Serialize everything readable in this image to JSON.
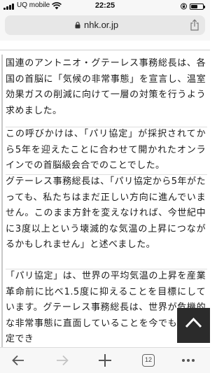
{
  "status_bar": {
    "carrier": "UQ mobile",
    "time": "22:25",
    "battery_level": 0.55,
    "icons": [
      "signal-icon",
      "wifi-icon",
      "lock-rotation-icon",
      "battery-icon"
    ]
  },
  "browser": {
    "url": "nhk.or.jp",
    "tab_count": "12",
    "icons": [
      "lock-icon",
      "share-icon",
      "back-icon",
      "forward-icon",
      "new-tab-icon",
      "tabs-icon",
      "more-icon"
    ]
  },
  "article": {
    "paragraphs": [
      "国連のアントニオ・グテーレス事務総長は、各国の首脳に「気候の非常事態」を宣言し、温室効果ガスの削減に向けて一層の対策を行うよう求めました。",
      "この呼びかけは、「パリ協定」が採択されてから5年を迎えたことに合わせて開かれたオンラインでの首脳級会合でのことでした。",
      "グテーレス事務総長は、「パリ協定から5年がたっても、私たちはまだ正しい方向に進んでいません。このまま方針を変えなければ、今世紀中に3度以上という壊滅的な気温の上昇につながるかもしれません」と述べました。",
      "「パリ協定」は、世界の平均気温の上昇を産業革命前に比べ1.5度に抑えることを目標にしています。グテーレス事務総長は、世界が危機的な非常事態に直面していることを今でも誰か否定でき"
    ]
  },
  "colors": {
    "accent": "#2b2b2b",
    "chrome": "#f7f7f7",
    "url_pill": "#e7e7e7"
  }
}
